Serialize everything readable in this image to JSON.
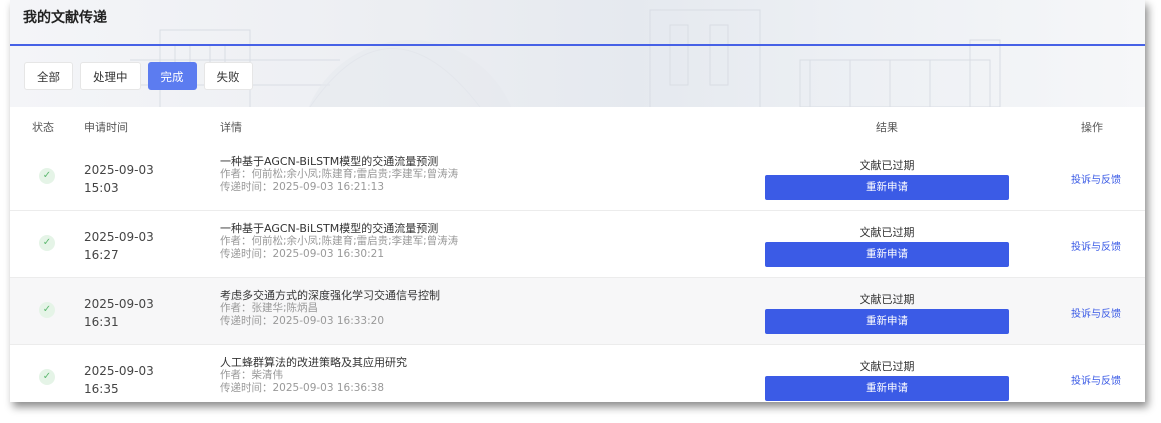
{
  "header": {
    "title": "我的文献传递"
  },
  "tabs": [
    {
      "label": "全部",
      "active": false
    },
    {
      "label": "处理中",
      "active": false
    },
    {
      "label": "完成",
      "active": true
    },
    {
      "label": "失败",
      "active": false
    }
  ],
  "table": {
    "columns": [
      "状态",
      "申请时间",
      "详情",
      "结果",
      "操作"
    ],
    "rows": [
      {
        "date": "2025-09-03",
        "time": "15:03",
        "title": "一种基于AGCN-BiLSTM模型的交通流量预测",
        "authors": "作者：何前松;余小凤;陈建育;雷启贵;李建军;曾涛涛",
        "delivered": "传递时间：2025-09-03 16:21:13",
        "status": "文献已过期",
        "button": "重新申请",
        "action": "投诉与反馈"
      },
      {
        "date": "2025-09-03",
        "time": "16:27",
        "title": "一种基于AGCN-BiLSTM模型的交通流量预测",
        "authors": "作者：何前松;余小凤;陈建育;雷启贵;李建军;曾涛涛",
        "delivered": "传递时间：2025-09-03 16:30:21",
        "status": "文献已过期",
        "button": "重新申请",
        "action": "投诉与反馈"
      },
      {
        "date": "2025-09-03",
        "time": "16:31",
        "title": "考虑多交通方式的深度强化学习交通信号控制",
        "authors": "作者：张建华;陈炳昌",
        "delivered": "传递时间：2025-09-03 16:33:20",
        "status": "文献已过期",
        "button": "重新申请",
        "action": "投诉与反馈"
      },
      {
        "date": "2025-09-03",
        "time": "16:35",
        "title": "人工蜂群算法的改进策略及其应用研究",
        "authors": "作者：柴清伟",
        "delivered": "传递时间：2025-09-03 16:36:38",
        "status": "文献已过期",
        "button": "重新申请",
        "action": "投诉与反馈"
      }
    ]
  },
  "icons": {
    "status": "check-icon"
  },
  "colors": {
    "accent": "#3b5be6",
    "tab_active": "#5c7cf0",
    "success": "#5fb971"
  }
}
